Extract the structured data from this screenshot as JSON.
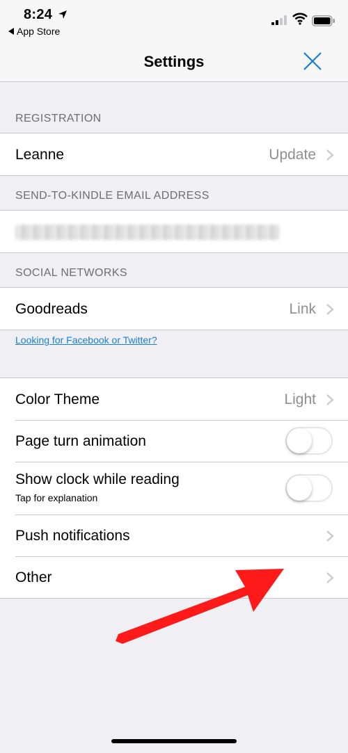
{
  "status_bar": {
    "time": "8:24",
    "back_app": "App Store"
  },
  "nav": {
    "title": "Settings"
  },
  "sections": {
    "registration": {
      "header": "REGISTRATION",
      "name": "Leanne",
      "action": "Update"
    },
    "email": {
      "header": "SEND-TO-KINDLE EMAIL ADDRESS"
    },
    "social": {
      "header": "SOCIAL NETWORKS",
      "service": "Goodreads",
      "action": "Link",
      "link_text": "Looking for Facebook or Twitter?"
    },
    "preferences": {
      "color_theme_label": "Color Theme",
      "color_theme_value": "Light",
      "page_turn_label": "Page turn animation",
      "page_turn_on": false,
      "clock_label": "Show clock while reading",
      "clock_sub": "Tap for explanation",
      "clock_on": false,
      "push_label": "Push notifications",
      "other_label": "Other"
    }
  },
  "colors": {
    "accent": "#1a7fd1",
    "arrow": "#ff1a1a"
  }
}
